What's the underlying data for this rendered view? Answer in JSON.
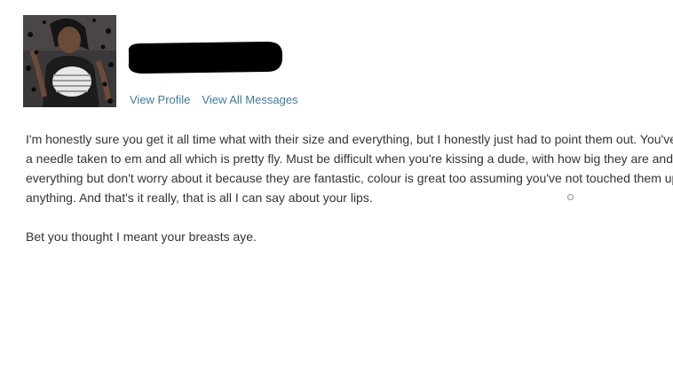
{
  "sender": {
    "avatar_alt": "profile photo",
    "name_redacted": true
  },
  "links": {
    "view_profile": "View Profile",
    "view_all_messages": "View All Messages"
  },
  "message": {
    "lines": [
      "I'm honestly sure you get it all time what with their size and everything, but I honestly just had to point them out. You've ha",
      "a needle taken to em and all which is pretty fly. Must be difficult when you're kissing a dude, with how big they are and",
      "everything but don't worry about it because they are fantastic, colour is great too assuming you've not touched them up w",
      "anything. And that's it really, that is all I can say about your lips."
    ],
    "postscript": "Bet you thought I meant your breasts aye."
  },
  "colors": {
    "link": "#3f7a9a",
    "text": "#333333",
    "redaction": "#000000"
  }
}
